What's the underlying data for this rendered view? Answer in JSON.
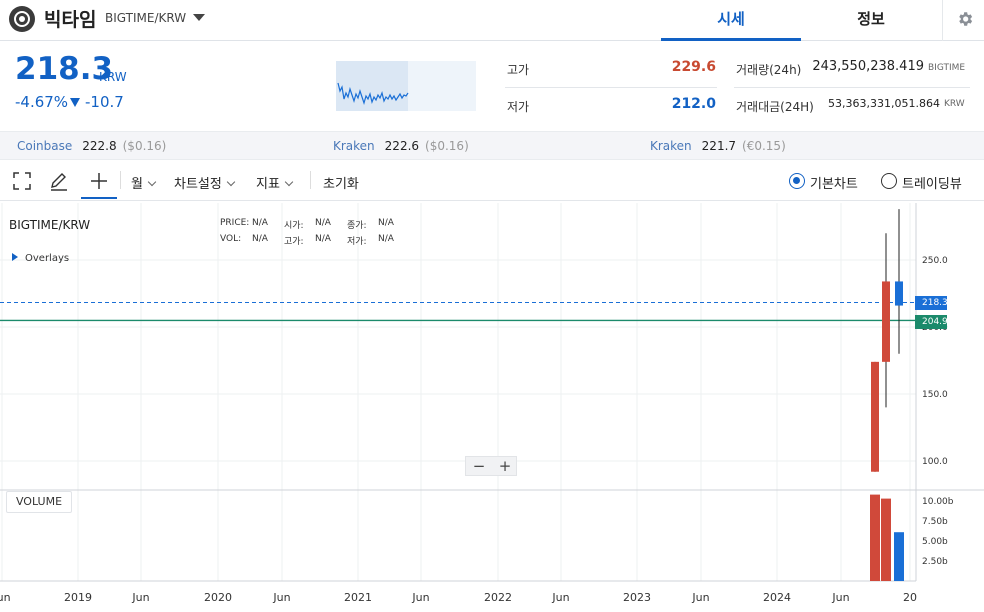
{
  "header": {
    "coin_name": "빅타임",
    "pair": "BIGTIME/KRW",
    "tabs": [
      {
        "label": "시세",
        "active": true
      },
      {
        "label": "정보",
        "active": false
      }
    ],
    "settings_icon": "gear-icon"
  },
  "price": {
    "current": "218.3",
    "unit": "KRW",
    "change_pct": "-4.67%",
    "change_abs": "-10.7",
    "direction": "down",
    "color": "#1261c4"
  },
  "stats": {
    "high_label": "고가",
    "high_value": "229.6",
    "low_label": "저가",
    "low_value": "212.0",
    "volume_label": "거래량(24h)",
    "volume_value": "243,550,238.419",
    "volume_unit": "BIGTIME",
    "amount_label": "거래대금(24H)",
    "amount_value": "53,363,331,051.864",
    "amount_unit": "KRW"
  },
  "exchanges": [
    {
      "name": "Coinbase",
      "price": "222.8",
      "diff": "($0.16)"
    },
    {
      "name": "Kraken",
      "price": "222.6",
      "diff": "($0.16)"
    },
    {
      "name": "Kraken",
      "price": "221.7",
      "diff": "(€0.15)"
    }
  ],
  "toolbar": {
    "fullscreen_icon": "fullscreen-icon",
    "draw_icon": "pencil-icon",
    "crosshair_icon": "crosshair-icon",
    "period": "월",
    "chart_settings": "차트설정",
    "indicators": "지표",
    "reset": "초기화",
    "view_basic": "기본차트",
    "view_trading": "트레이딩뷰",
    "selected_view": "기본차트"
  },
  "chart": {
    "title": "BIGTIME/KRW",
    "legend_row1": [
      [
        "PRICE:",
        "N/A"
      ],
      [
        "시가:",
        "N/A"
      ],
      [
        "종가:",
        "N/A"
      ]
    ],
    "legend_row2": [
      [
        "VOL:",
        "N/A"
      ],
      [
        "고가:",
        "N/A"
      ],
      [
        "저가:",
        "N/A"
      ]
    ],
    "overlays": "Overlays",
    "zoom_out": "−",
    "zoom_in": "+",
    "volume_label": "VOLUME",
    "current_price_tag": "218.3",
    "reference_price_tag": "204.9",
    "colors": {
      "up": "#d0493a",
      "down": "#1a6fd6",
      "reference": "#1b8a6b"
    }
  },
  "chart_data": {
    "type": "candlestick",
    "x_ticks": [
      "Jun",
      "2019",
      "Jun",
      "2020",
      "Jun",
      "2021",
      "Jun",
      "2022",
      "Jun",
      "2023",
      "Jun",
      "2024",
      "Jun",
      "20"
    ],
    "y_ticks": [
      "250.0",
      "200.0",
      "150.0",
      "100.0"
    ],
    "volume_ticks": [
      "10.00b",
      "7.50b",
      "5.00b",
      "2.50b"
    ],
    "ylim": [
      75,
      290
    ],
    "volume_ylim": [
      0,
      12000000000
    ],
    "candles": [
      {
        "open": 92,
        "high": 174,
        "low": 92,
        "close": 174,
        "direction": "up"
      },
      {
        "open": 174,
        "high": 270,
        "low": 140,
        "close": 234,
        "direction": "up"
      },
      {
        "open": 234,
        "high": 288,
        "low": 180,
        "close": 216,
        "direction": "down"
      }
    ],
    "volume": [
      10800000000,
      10300000000,
      6100000000
    ],
    "last_price": 218.3,
    "reference_price": 204.9
  }
}
